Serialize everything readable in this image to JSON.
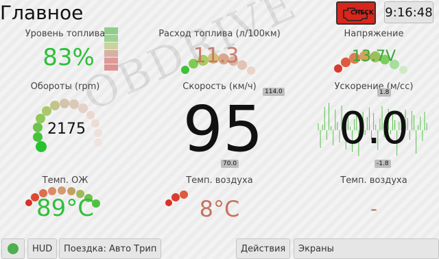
{
  "header": {
    "title": "Главное",
    "check_label": "CHECK",
    "clock": "9:16:48"
  },
  "watermark": "OBDRIVE",
  "gauges": {
    "fuel_level": {
      "label": "Уровень топлива",
      "value": "83%",
      "color": "#2fbf3a"
    },
    "fuel_consumption": {
      "label": "Расход топлива (л/100км)",
      "value": "11.3",
      "color": "#c4745f"
    },
    "voltage": {
      "label": "Напряжение",
      "value": "13.7V",
      "color": "#3aa83a"
    },
    "rpm": {
      "label": "Обороты (rpm)",
      "value": "2175",
      "color": "#111111"
    },
    "speed": {
      "label": "Скорость (км/ч)",
      "value": "95",
      "max_chip": "114.0",
      "min_chip": "70.0",
      "color": "#111111"
    },
    "acceleration": {
      "label": "Ускорение (м/сс)",
      "value": "0.0",
      "max_chip": "1.8",
      "min_chip": "-1.8",
      "color": "#111111"
    },
    "coolant_temp": {
      "label": "Темп. ОЖ",
      "value": "89°C",
      "color": "#2fbf3a"
    },
    "air_temp": {
      "label": "Темп. воздуха",
      "value": "8°C",
      "color": "#c4745f"
    },
    "air_temp_2": {
      "label": "Темп. воздуха",
      "value": "-",
      "color": "#c4745f"
    }
  },
  "bottom_bar": {
    "hud_label": "HUD",
    "trip_label": "Поездка: Авто Трип",
    "actions_label": "Действия",
    "screens_label": "Экраны",
    "status_color": "#4caf50"
  }
}
